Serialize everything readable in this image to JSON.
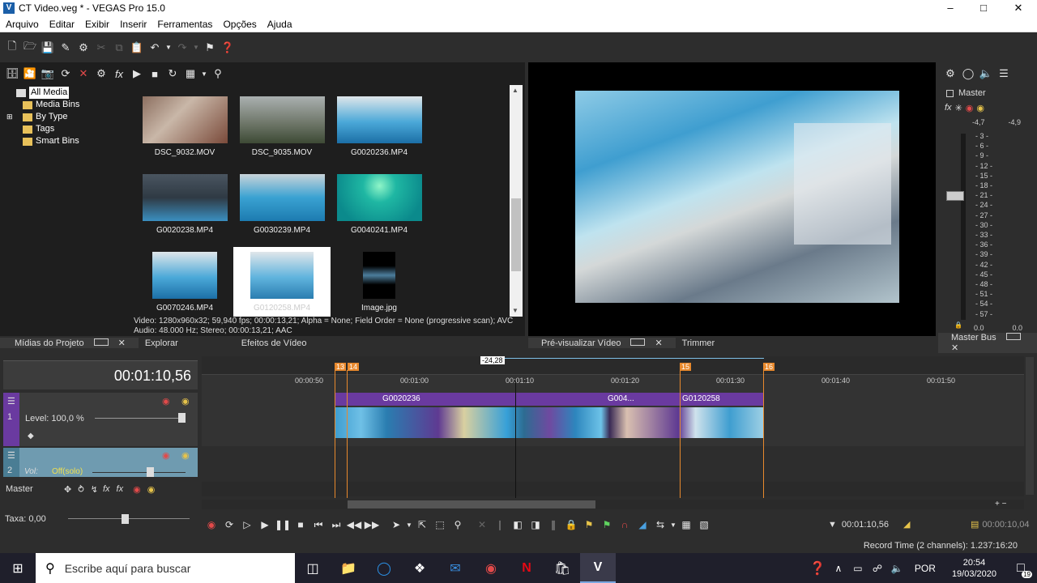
{
  "window": {
    "title": "CT Video.veg * - VEGAS Pro 15.0",
    "app_logo": "V"
  },
  "menu": [
    "Arquivo",
    "Editar",
    "Exibir",
    "Inserir",
    "Ferramentas",
    "Opções",
    "Ajuda"
  ],
  "explorer": {
    "tree": [
      "All Media",
      "Media Bins",
      "By Type",
      "Tags",
      "Smart Bins"
    ],
    "items": [
      "DSC_9032.MOV",
      "DSC_9035.MOV",
      "G0020236.MP4",
      "G0020238.MP4",
      "G0030239.MP4",
      "G0040241.MP4",
      "G0070246.MP4",
      "G0120258.MP4",
      "Image.jpg"
    ],
    "info_line1": "Video: 1280x960x32; 59,940 fps; 00:00:13,21; Alpha = None; Field Order = None (progressive scan); AVC",
    "info_line2": "Audio: 48.000 Hz; Stereo; 00:00:13,21; AAC",
    "tabs": [
      "Mídias do Projeto",
      "Explorar",
      "Efeitos de Vídeo"
    ]
  },
  "preview": {
    "tabs": [
      "Pré-visualizar Vídeo",
      "Trimmer"
    ]
  },
  "master": {
    "label": "Master",
    "peak_left": "-4,7",
    "peak_right": "-4,9",
    "scale": [
      "3",
      "6",
      "9",
      "12",
      "15",
      "18",
      "21",
      "24",
      "27",
      "30",
      "33",
      "36",
      "39",
      "42",
      "45",
      "48",
      "51",
      "54",
      "57"
    ],
    "val_left": "0.0",
    "val_right": "0.0",
    "tab": "Master Bus"
  },
  "timeline": {
    "timecode": "00:01:10,56",
    "selection": "-24,28",
    "markers": [
      "13",
      "14",
      "15",
      "16"
    ],
    "ruler": [
      "00:00:50",
      "00:01:00",
      "00:01:10",
      "00:01:20",
      "00:01:30",
      "00:01:40",
      "00:01:50"
    ],
    "track1": {
      "num": "1",
      "level": "Level: 100,0 %"
    },
    "track2": {
      "num": "2",
      "vol_label": "Vol:",
      "vol_value": "Off(solo)"
    },
    "master_label": "Master",
    "rate": "Taxa: 0,00",
    "clips": [
      "G0020236",
      "G004...",
      "G0120258"
    ],
    "cursor_time": "00:01:10,56",
    "sel_length": "00:00:10,04",
    "record_time": "Record Time (2 channels): 1.237:16:20"
  },
  "taskbar": {
    "search_placeholder": "Escribe aquí para buscar",
    "lang": "POR",
    "time": "20:54",
    "date": "19/03/2020",
    "notif_count": "19"
  },
  "colors": {
    "accent_purple": "#6a3aa0",
    "marker_orange": "#e8892d",
    "track2_blue": "#6f9bb0"
  }
}
